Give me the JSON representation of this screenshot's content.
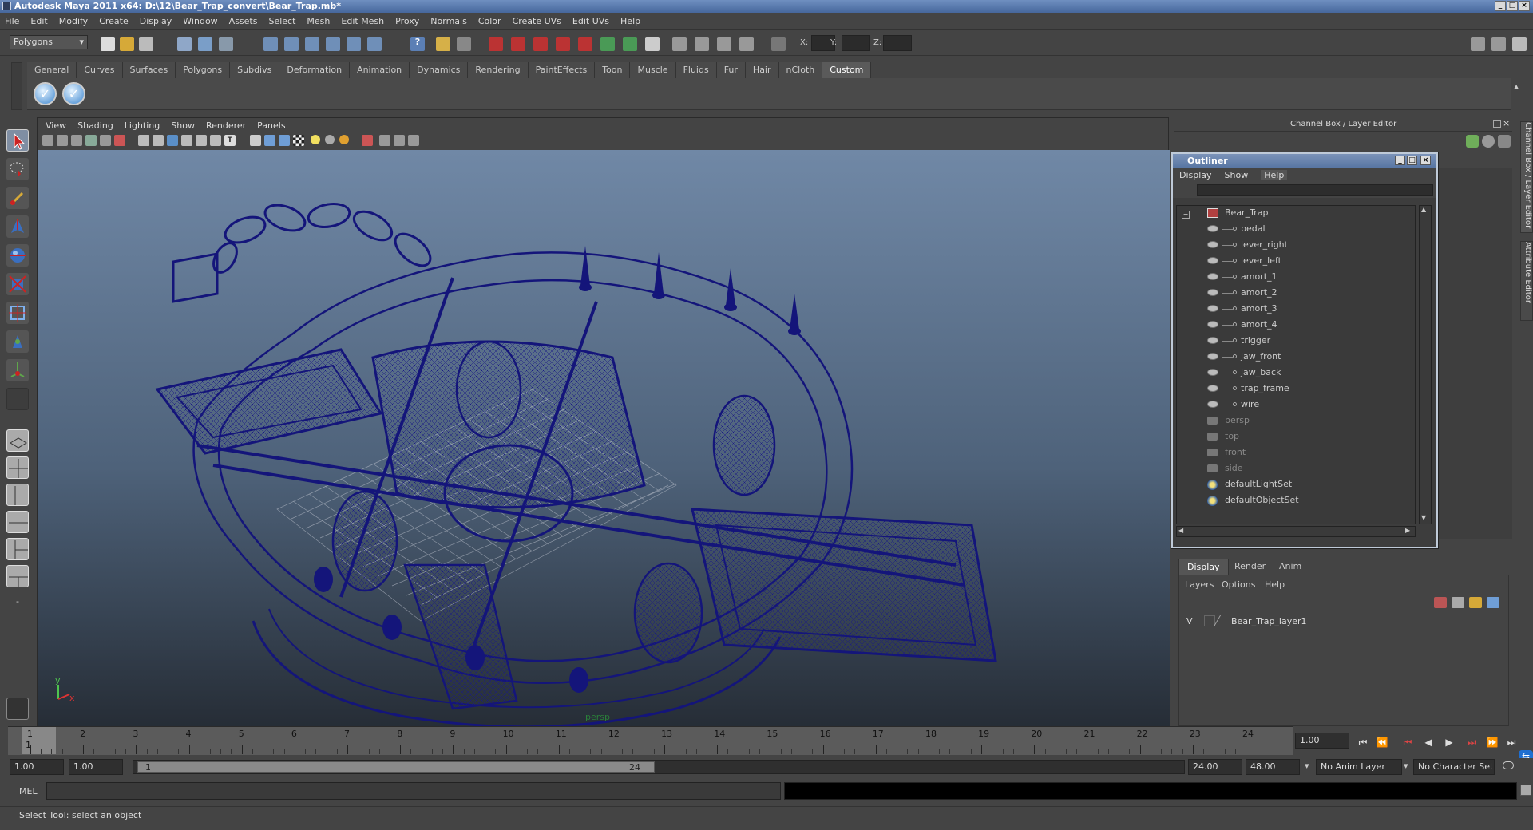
{
  "window": {
    "title": "Autodesk Maya 2011 x64: D:\\12\\Bear_Trap_convert\\Bear_Trap.mb*"
  },
  "menubar": [
    "File",
    "Edit",
    "Modify",
    "Create",
    "Display",
    "Window",
    "Assets",
    "Select",
    "Mesh",
    "Edit Mesh",
    "Proxy",
    "Normals",
    "Color",
    "Create UVs",
    "Edit UVs",
    "Help"
  ],
  "status": {
    "mode": "Polygons",
    "x_label": "X:",
    "y_label": "Y:",
    "z_label": "Z:"
  },
  "shelf": {
    "tabs": [
      "General",
      "Curves",
      "Surfaces",
      "Polygons",
      "Subdivs",
      "Deformation",
      "Animation",
      "Dynamics",
      "Rendering",
      "PaintEffects",
      "Toon",
      "Muscle",
      "Fluids",
      "Fur",
      "Hair",
      "nCloth",
      "Custom"
    ],
    "active": "Custom"
  },
  "viewport": {
    "menu": [
      "View",
      "Shading",
      "Lighting",
      "Show",
      "Renderer",
      "Panels"
    ],
    "camera": "persp",
    "axis_x": "x",
    "axis_y": "y"
  },
  "channelbox": {
    "title": "Channel Box / Layer Editor"
  },
  "sidetabs": {
    "channel": "Channel Box / Layer Editor",
    "attr": "Attribute Editor"
  },
  "outliner": {
    "title": "Outliner",
    "menu": [
      "Display",
      "Show",
      "Help"
    ],
    "root": "Bear_Trap",
    "children": [
      "pedal",
      "lever_right",
      "lever_left",
      "amort_1",
      "amort_2",
      "amort_3",
      "amort_4",
      "trigger",
      "jaw_front",
      "jaw_back",
      "trap_frame",
      "wire"
    ],
    "cameras": [
      "persp",
      "top",
      "front",
      "side"
    ],
    "sets": [
      "defaultLightSet",
      "defaultObjectSet"
    ]
  },
  "layers": {
    "tabs": [
      "Display",
      "Render",
      "Anim"
    ],
    "menu": [
      "Layers",
      "Options",
      "Help"
    ],
    "visible_flag": "V",
    "items": [
      "Bear_Trap_layer1"
    ]
  },
  "timeline": {
    "ticks": [
      "1",
      "2",
      "3",
      "4",
      "5",
      "6",
      "7",
      "8",
      "9",
      "10",
      "11",
      "12",
      "13",
      "14",
      "15",
      "16",
      "17",
      "18",
      "19",
      "20",
      "21",
      "22",
      "23",
      "24"
    ],
    "current_frame": "1.00",
    "current_marker": "1"
  },
  "range": {
    "start": "1.00",
    "anim_start": "1.00",
    "range_start": "1",
    "range_end": "24",
    "anim_end": "24.00",
    "end": "48.00",
    "anim_layer": "No Anim Layer",
    "char_set": "No Character Set"
  },
  "cmd": {
    "label": "MEL"
  },
  "help": {
    "text": "Select Tool: select an object"
  },
  "colors": {
    "wire": "#14157a",
    "accent": "#5876a3"
  }
}
